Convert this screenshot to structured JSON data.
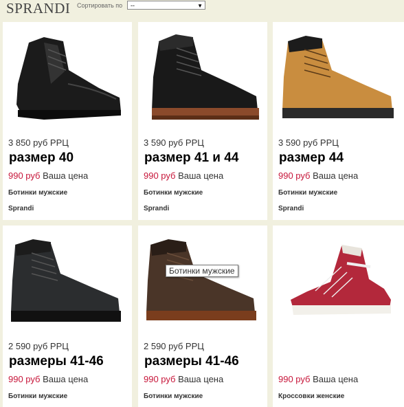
{
  "header": {
    "brand": "SPRANDI",
    "sort_label": "Сортировать по",
    "sort_value": "--"
  },
  "products": [
    {
      "rrp": "3 850 руб РРЦ",
      "size": "размер 40",
      "price": "990 руб",
      "price_suffix": " Ваша цена",
      "category": "Ботинки мужские",
      "brand": "Sprandi",
      "image": "black-leather-chukka-boot"
    },
    {
      "rrp": "3 590 руб РРЦ",
      "size": "размер 41 и 44",
      "price": "990 руб",
      "price_suffix": " Ваша цена",
      "category": "Ботинки мужские",
      "brand": "Sprandi",
      "image": "black-work-boot"
    },
    {
      "rrp": "3 590 руб РРЦ",
      "size": "размер 44",
      "price": "990 руб",
      "price_suffix": " Ваша цена",
      "category": "Ботинки мужские",
      "brand": "Sprandi",
      "image": "tan-work-boot"
    },
    {
      "rrp": "2 590 руб РРЦ",
      "size": "размеры 41-46",
      "price": "990 руб",
      "price_suffix": " Ваша цена",
      "category": "Ботинки мужские",
      "image": "black-nubuck-boot"
    },
    {
      "rrp": "2 590 руб РРЦ",
      "size": "размеры 41-46",
      "price": "990 руб",
      "price_suffix": " Ваша цена",
      "category": "Ботинки мужские",
      "image": "brown-nubuck-boot"
    },
    {
      "price": "990 руб",
      "price_suffix": " Ваша цена",
      "category": "Кроссовки женские",
      "image": "red-hightop-sneaker"
    }
  ],
  "tooltip": "Ботинки мужские",
  "colors": {
    "price_red": "#c7163a",
    "background": "#f1f0df"
  }
}
